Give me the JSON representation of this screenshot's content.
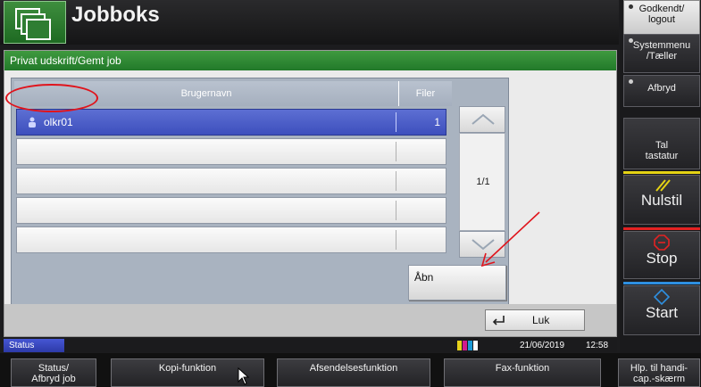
{
  "header": {
    "title": "Jobboks",
    "icon": "jobbox-folders-icon"
  },
  "panel": {
    "title": "Privat udskrift/Gemt job",
    "columns": {
      "user": "Brugernavn",
      "files": "Filer"
    },
    "rows": [
      {
        "user": "olkr01",
        "files": "1",
        "selected": true
      },
      {
        "user": "",
        "files": ""
      },
      {
        "user": "",
        "files": ""
      },
      {
        "user": "",
        "files": ""
      },
      {
        "user": "",
        "files": ""
      }
    ],
    "page_indicator": "1/1",
    "open_label": "Åbn",
    "close_label": "Luk"
  },
  "status": {
    "label": "Status",
    "date": "21/06/2019",
    "time": "12:58"
  },
  "func_bar": {
    "status_cancel": "Status/\nAfbryd job",
    "copy": "Kopi-funktion",
    "send": "Afsendelsesfunktion",
    "fax": "Fax-funktion",
    "accessibility": "Hlp. til handi-\ncap.-skærm"
  },
  "side": {
    "login": "Godkendt/\nlogout",
    "system_menu": "Systemmenu\n/Tæller",
    "interrupt": "Afbryd",
    "numpad": "Tal\ntastatur",
    "reset": "Nulstil",
    "stop": "Stop",
    "start": "Start"
  },
  "colors": {
    "title_green": "#2f8a33",
    "selected_row": "#4b5dc8",
    "annotation_red": "#e0141c",
    "status_blue": "#3a48c0"
  }
}
